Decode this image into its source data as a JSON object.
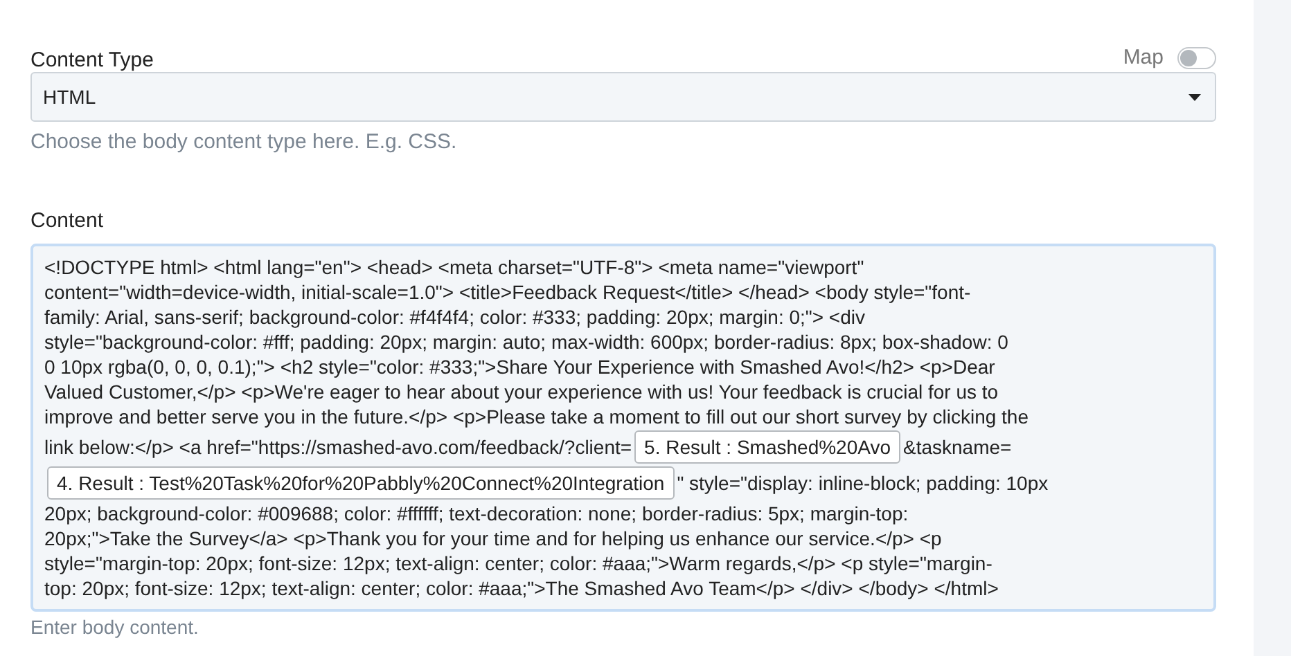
{
  "content_type": {
    "label": "Content Type",
    "map_toggle": {
      "label": "Map",
      "on": false
    },
    "select": {
      "value": "HTML"
    },
    "hint": "Choose the body content type here. E.g. CSS."
  },
  "content": {
    "label": "Content",
    "lines": [
      [
        {
          "kind": "text",
          "text": "<!DOCTYPE html> <html lang=\"en\"> <head> <meta charset=\"UTF-8\"> <meta name=\"viewport\""
        }
      ],
      [
        {
          "kind": "text",
          "text": "content=\"width=device-width, initial-scale=1.0\"> <title>Feedback Request</title> </head> <body style=\"font-"
        }
      ],
      [
        {
          "kind": "text",
          "text": "family: Arial, sans-serif; background-color: #f4f4f4; color: #333; padding: 20px; margin: 0;\"> <div"
        }
      ],
      [
        {
          "kind": "text",
          "text": "style=\"background-color: #fff; padding: 20px; margin: auto; max-width: 600px; border-radius: 8px; box-shadow: 0"
        }
      ],
      [
        {
          "kind": "text",
          "text": "0 10px rgba(0, 0, 0, 0.1);\"> <h2 style=\"color: #333;\">Share Your Experience with Smashed Avo!</h2> <p>Dear"
        }
      ],
      [
        {
          "kind": "text",
          "text": "Valued Customer,</p> <p>We're eager to hear about your experience with us! Your feedback is crucial for us to"
        }
      ],
      [
        {
          "kind": "text",
          "text": "improve and better serve you in the future.</p> <p>Please take a moment to fill out our short survey by clicking the"
        }
      ],
      [
        {
          "kind": "text",
          "text": "link below:</p> <a href=\"https://smashed-avo.com/feedback/?client="
        },
        {
          "kind": "token",
          "text": "5. Result : Smashed%20Avo"
        },
        {
          "kind": "text",
          "text": "&taskname="
        }
      ],
      [
        {
          "kind": "token",
          "text": "4. Result : Test%20Task%20for%20Pabbly%20Connect%20Integration"
        },
        {
          "kind": "text",
          "text": "\" style=\"display: inline-block; padding: 10px"
        }
      ],
      [
        {
          "kind": "text",
          "text": "20px; background-color: #009688; color: #ffffff; text-decoration: none; border-radius: 5px; margin-top:"
        }
      ],
      [
        {
          "kind": "text",
          "text": "20px;\">Take the Survey</a> <p>Thank you for your time and for helping us enhance our service.</p> <p"
        }
      ],
      [
        {
          "kind": "text",
          "text": "style=\"margin-top: 20px; font-size: 12px; text-align: center; color: #aaa;\">Warm regards,</p> <p style=\"margin-"
        }
      ],
      [
        {
          "kind": "text",
          "text": "top: 20px; font-size: 12px; text-align: center; color: #aaa;\">The Smashed Avo Team</p> </div> </body> </html>"
        }
      ]
    ],
    "hint": "Enter body content."
  }
}
